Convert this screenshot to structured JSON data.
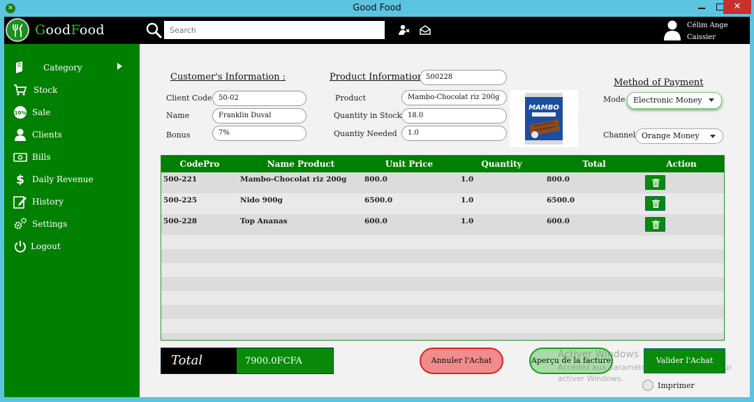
{
  "window": {
    "title": "Good Food",
    "close_glyph": "✕"
  },
  "header": {
    "logo_prefix_g": "G",
    "logo_text_1": "ood",
    "logo_prefix_f": "F",
    "logo_text_2": "ood",
    "search_placeholder": "Search",
    "user_line1": "Célim Ange",
    "user_line2": "Caissier"
  },
  "sidebar": {
    "items": [
      {
        "label": "Category",
        "icon": "tag-icon"
      },
      {
        "label": "Stock",
        "icon": "cart-icon"
      },
      {
        "label": "Sale",
        "icon": "percent-icon"
      },
      {
        "label": "Clients",
        "icon": "person-icon"
      },
      {
        "label": "Bills",
        "icon": "money-icon"
      },
      {
        "label": "Daily Revenue",
        "icon": "dollar-icon"
      },
      {
        "label": "History",
        "icon": "edit-icon"
      },
      {
        "label": "Settings",
        "icon": "gears-icon"
      },
      {
        "label": "Logout",
        "icon": "power-icon"
      }
    ]
  },
  "customer": {
    "title": "Customer's Information :",
    "client_code_label": "Client Code",
    "client_code": "50-02",
    "name_label": "Name",
    "name": "Franklin Duval",
    "bonus_label": "Bonus",
    "bonus": "7%"
  },
  "product": {
    "title": "Product Information :",
    "code": "500228",
    "product_label": "Product",
    "product": "Mambo-Chocolat riz 200g",
    "stock_label": "Quantity in Stock",
    "stock": "18.0",
    "needed_label": "Quantiy Needed",
    "needed": "1.0",
    "image_brand": "MAMBO"
  },
  "payment": {
    "title": "Method of Payment",
    "mode_label": "Mode",
    "mode": "Electronic Money",
    "channel_label": "Channel",
    "channel": "Orange Money"
  },
  "table": {
    "headers": [
      "CodePro",
      "Name Product",
      "Unit Price",
      "Quantity",
      "Total",
      "Action"
    ],
    "rows": [
      {
        "code": "500-221",
        "name": "Mambo-Chocolat riz 200g",
        "price": "800.0",
        "qty": "1.0",
        "total": "800.0"
      },
      {
        "code": "500-225",
        "name": "Nido 900g",
        "price": "6500.0",
        "qty": "1.0",
        "total": "6500.0"
      },
      {
        "code": "500-228",
        "name": "Top Ananas",
        "price": "600.0",
        "qty": "1.0",
        "total": "600.0"
      }
    ]
  },
  "footer": {
    "total_label": "Total",
    "total_value": "7900.0FCFA",
    "cancel_label": "Annuler l'Achat",
    "preview_label": "Aperçu de la facture",
    "validate_label": "Valider l'Achat",
    "print_label": "Imprimer"
  },
  "watermark": {
    "line1": "Activer Windows",
    "line2": "Accédez aux paramètres de l'ordinateur pour",
    "line3": "activer Windows."
  },
  "colors": {
    "primary_green": "#008000",
    "header_black": "#000000",
    "cancel_red": "#e02020",
    "titlebar_blue": "#5bc4e0"
  }
}
